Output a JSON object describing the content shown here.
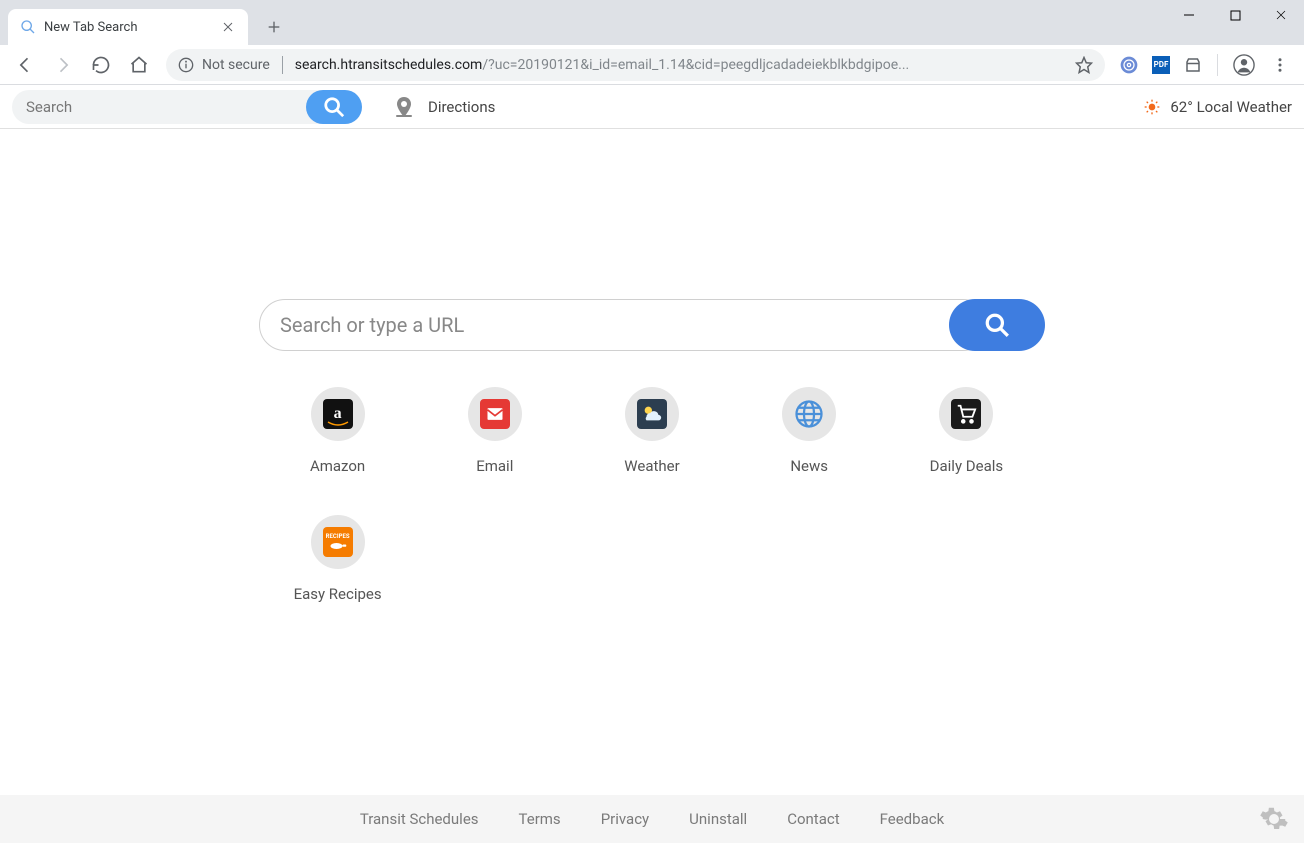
{
  "browser": {
    "tab_title": "New Tab Search",
    "not_secure_label": "Not secure",
    "url_domain": "search.htransitschedules.com",
    "url_path": "/?uc=20190121&i_id=email_1.14&cid=peegdljcadadeiekblkbdgipoe..."
  },
  "extbar": {
    "search_placeholder": "Search",
    "directions_label": "Directions",
    "weather_temp": "62°",
    "weather_label": "Local Weather"
  },
  "main": {
    "search_placeholder": "Search or type a URL"
  },
  "shortcuts": [
    {
      "label": "Amazon"
    },
    {
      "label": "Email"
    },
    {
      "label": "Weather"
    },
    {
      "label": "News"
    },
    {
      "label": "Daily Deals"
    },
    {
      "label": "Easy Recipes"
    }
  ],
  "footer": {
    "links": [
      "Transit Schedules",
      "Terms",
      "Privacy",
      "Uninstall",
      "Contact",
      "Feedback"
    ]
  }
}
